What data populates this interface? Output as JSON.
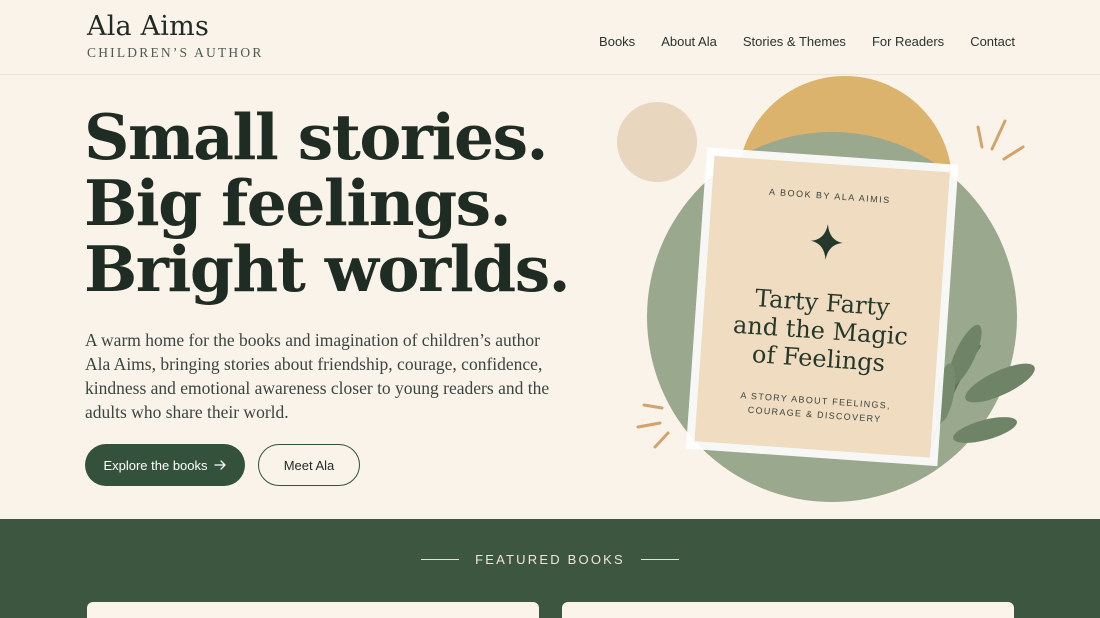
{
  "header": {
    "brand_name": "Ala Aims",
    "brand_tagline": "CHILDREN’S AUTHOR",
    "nav": [
      "Books",
      "About Ala",
      "Stories & Themes",
      "For Readers",
      "Contact"
    ]
  },
  "hero": {
    "title_lines": [
      "Small stories.",
      "Big feelings.",
      "Bright worlds."
    ],
    "description": "A warm home for the books and imagination of children’s author Ala Aims, bringing stories about friendship, courage, confidence, kindness and emotional awareness closer to young readers and the adults who share their world.",
    "primary_button": "Explore the books",
    "primary_button_icon": "arrow-right-icon",
    "secondary_button": "Meet Ala"
  },
  "book_cover": {
    "byline": "A BOOK BY ALA AIMIS",
    "title_lines": [
      "Tarty Farty",
      "and the Magic",
      "of Feelings"
    ],
    "subtitle_lines": [
      "A STORY ABOUT FEELINGS,",
      "COURAGE & DISCOVERY"
    ],
    "icon": "sparkle-star-icon"
  },
  "featured": {
    "label": "FEATURED BOOKS"
  },
  "colors": {
    "background": "#faf3ea",
    "primary_green": "#33513b",
    "featured_band": "#3d563f",
    "sage_circle": "#97a68a",
    "gold_circle": "#ddb268",
    "beige_circle": "#e6d4bd",
    "cover": "#f0dcc0"
  }
}
